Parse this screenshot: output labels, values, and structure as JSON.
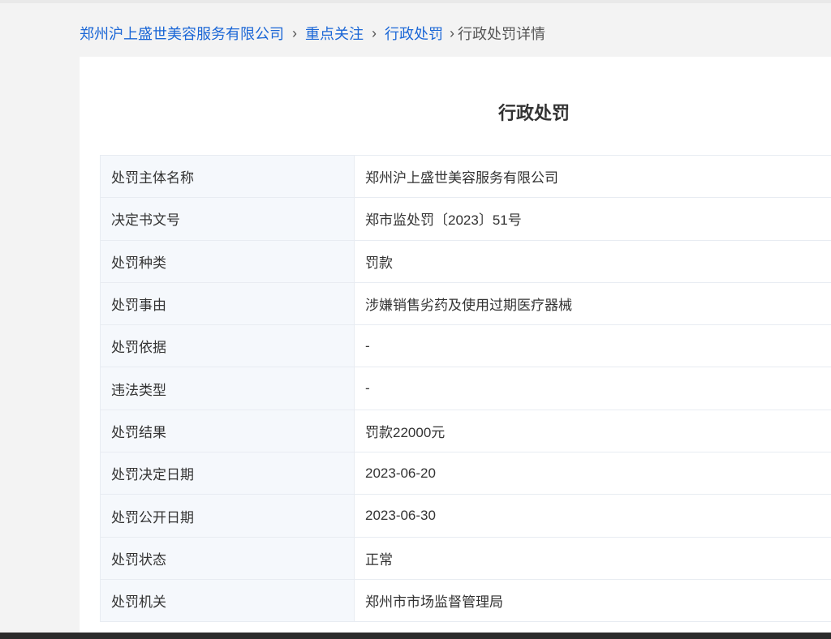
{
  "breadcrumb": {
    "items": [
      {
        "label": "郑州沪上盛世美容服务有限公司",
        "link": true
      },
      {
        "label": "重点关注",
        "link": true
      },
      {
        "label": "行政处罚",
        "link": true
      },
      {
        "label": "行政处罚详情",
        "link": false
      }
    ],
    "separator": "›"
  },
  "detail": {
    "title": "行政处罚",
    "rows": [
      {
        "label": "处罚主体名称",
        "value": "郑州沪上盛世美容服务有限公司"
      },
      {
        "label": "决定书文号",
        "value": "郑市监处罚〔2023〕51号"
      },
      {
        "label": "处罚种类",
        "value": "罚款"
      },
      {
        "label": "处罚事由",
        "value": "涉嫌销售劣药及使用过期医疗器械"
      },
      {
        "label": "处罚依据",
        "value": "-"
      },
      {
        "label": "违法类型",
        "value": "-"
      },
      {
        "label": "处罚结果",
        "value": "罚款22000元"
      },
      {
        "label": "处罚决定日期",
        "value": "2023-06-20"
      },
      {
        "label": "处罚公开日期",
        "value": "2023-06-30"
      },
      {
        "label": "处罚状态",
        "value": "正常"
      },
      {
        "label": "处罚机关",
        "value": "郑州市市场监督管理局"
      }
    ]
  },
  "colors": {
    "link": "#1a66d6",
    "label_bg": "#f5f8fc",
    "page_bg": "#f3f3f3"
  }
}
